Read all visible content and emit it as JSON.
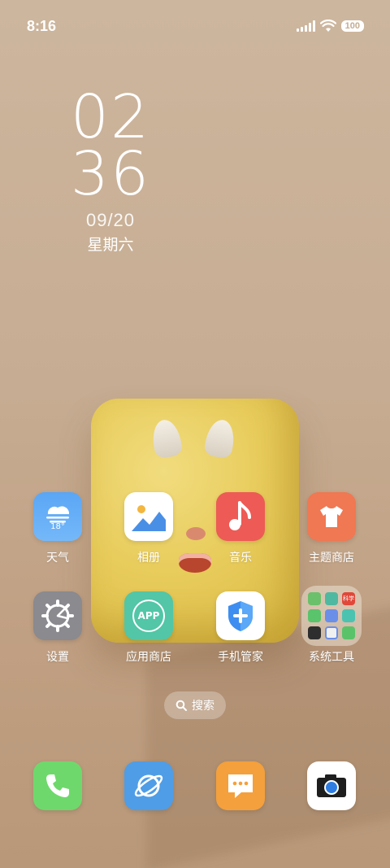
{
  "status_bar": {
    "time": "8:16",
    "battery": "100"
  },
  "clock": {
    "hours": "02",
    "minutes": "36",
    "date": "09/20",
    "weekday": "星期六"
  },
  "apps": {
    "weather": {
      "label": "天气",
      "temp": "18°"
    },
    "gallery": {
      "label": "相册"
    },
    "music": {
      "label": "音乐"
    },
    "themes": {
      "label": "主题商店"
    },
    "settings": {
      "label": "设置"
    },
    "app_store": {
      "label": "应用商店",
      "badge": "APP"
    },
    "security": {
      "label": "手机管家"
    },
    "system_tools": {
      "label": "系统工具",
      "mini_label": "科学"
    }
  },
  "search": {
    "label": "搜索"
  },
  "dock": [
    {
      "name": "phone"
    },
    {
      "name": "browser"
    },
    {
      "name": "messages"
    },
    {
      "name": "camera"
    }
  ],
  "colors": {
    "weather": "#5fa8f4",
    "music": "#ee5a55",
    "themes": "#f07852",
    "settings": "#8a8a8f",
    "app_store": "#52c6a6",
    "phone": "#6fd86c",
    "browser": "#4f9de6",
    "messages": "#f4a03c"
  }
}
